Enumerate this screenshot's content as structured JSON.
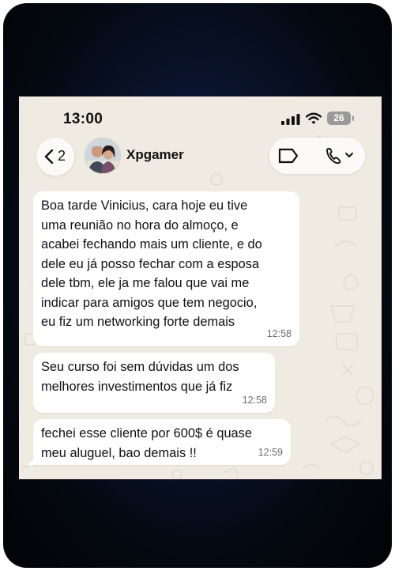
{
  "status_bar": {
    "time": "13:00",
    "battery": "26",
    "signal_icon": "cellular-signal-icon",
    "wifi_icon": "wifi-icon"
  },
  "header": {
    "back_count": "2",
    "contact_name": "Xpgamer",
    "avatar_icon": "contact-photo",
    "label_icon": "label-tag-icon",
    "call_icon": "phone-call-icon"
  },
  "messages": [
    {
      "text": "Boa tarde Vinicius, cara hoje eu tive\numa reunião no hora do almoço, e\nacabei fechando mais um cliente, e do\ndele eu já posso fechar com a esposa\ndele tbm, ele ja me falou que vai me\nindicar para amigos que tem negocio,\neu fiz um networking forte demais",
      "time": "12:58"
    },
    {
      "text": "Seu curso foi sem dúvidas um dos\nmelhores investimentos que já fiz",
      "time": "12:58"
    },
    {
      "text": "fechei esse cliente por 600$ é quase\nmeu aluguel, bao demais !!",
      "time": "12:59"
    }
  ],
  "colors": {
    "chat_background": "#efeae2",
    "bubble": "#ffffff",
    "frame": "#0a1530"
  }
}
